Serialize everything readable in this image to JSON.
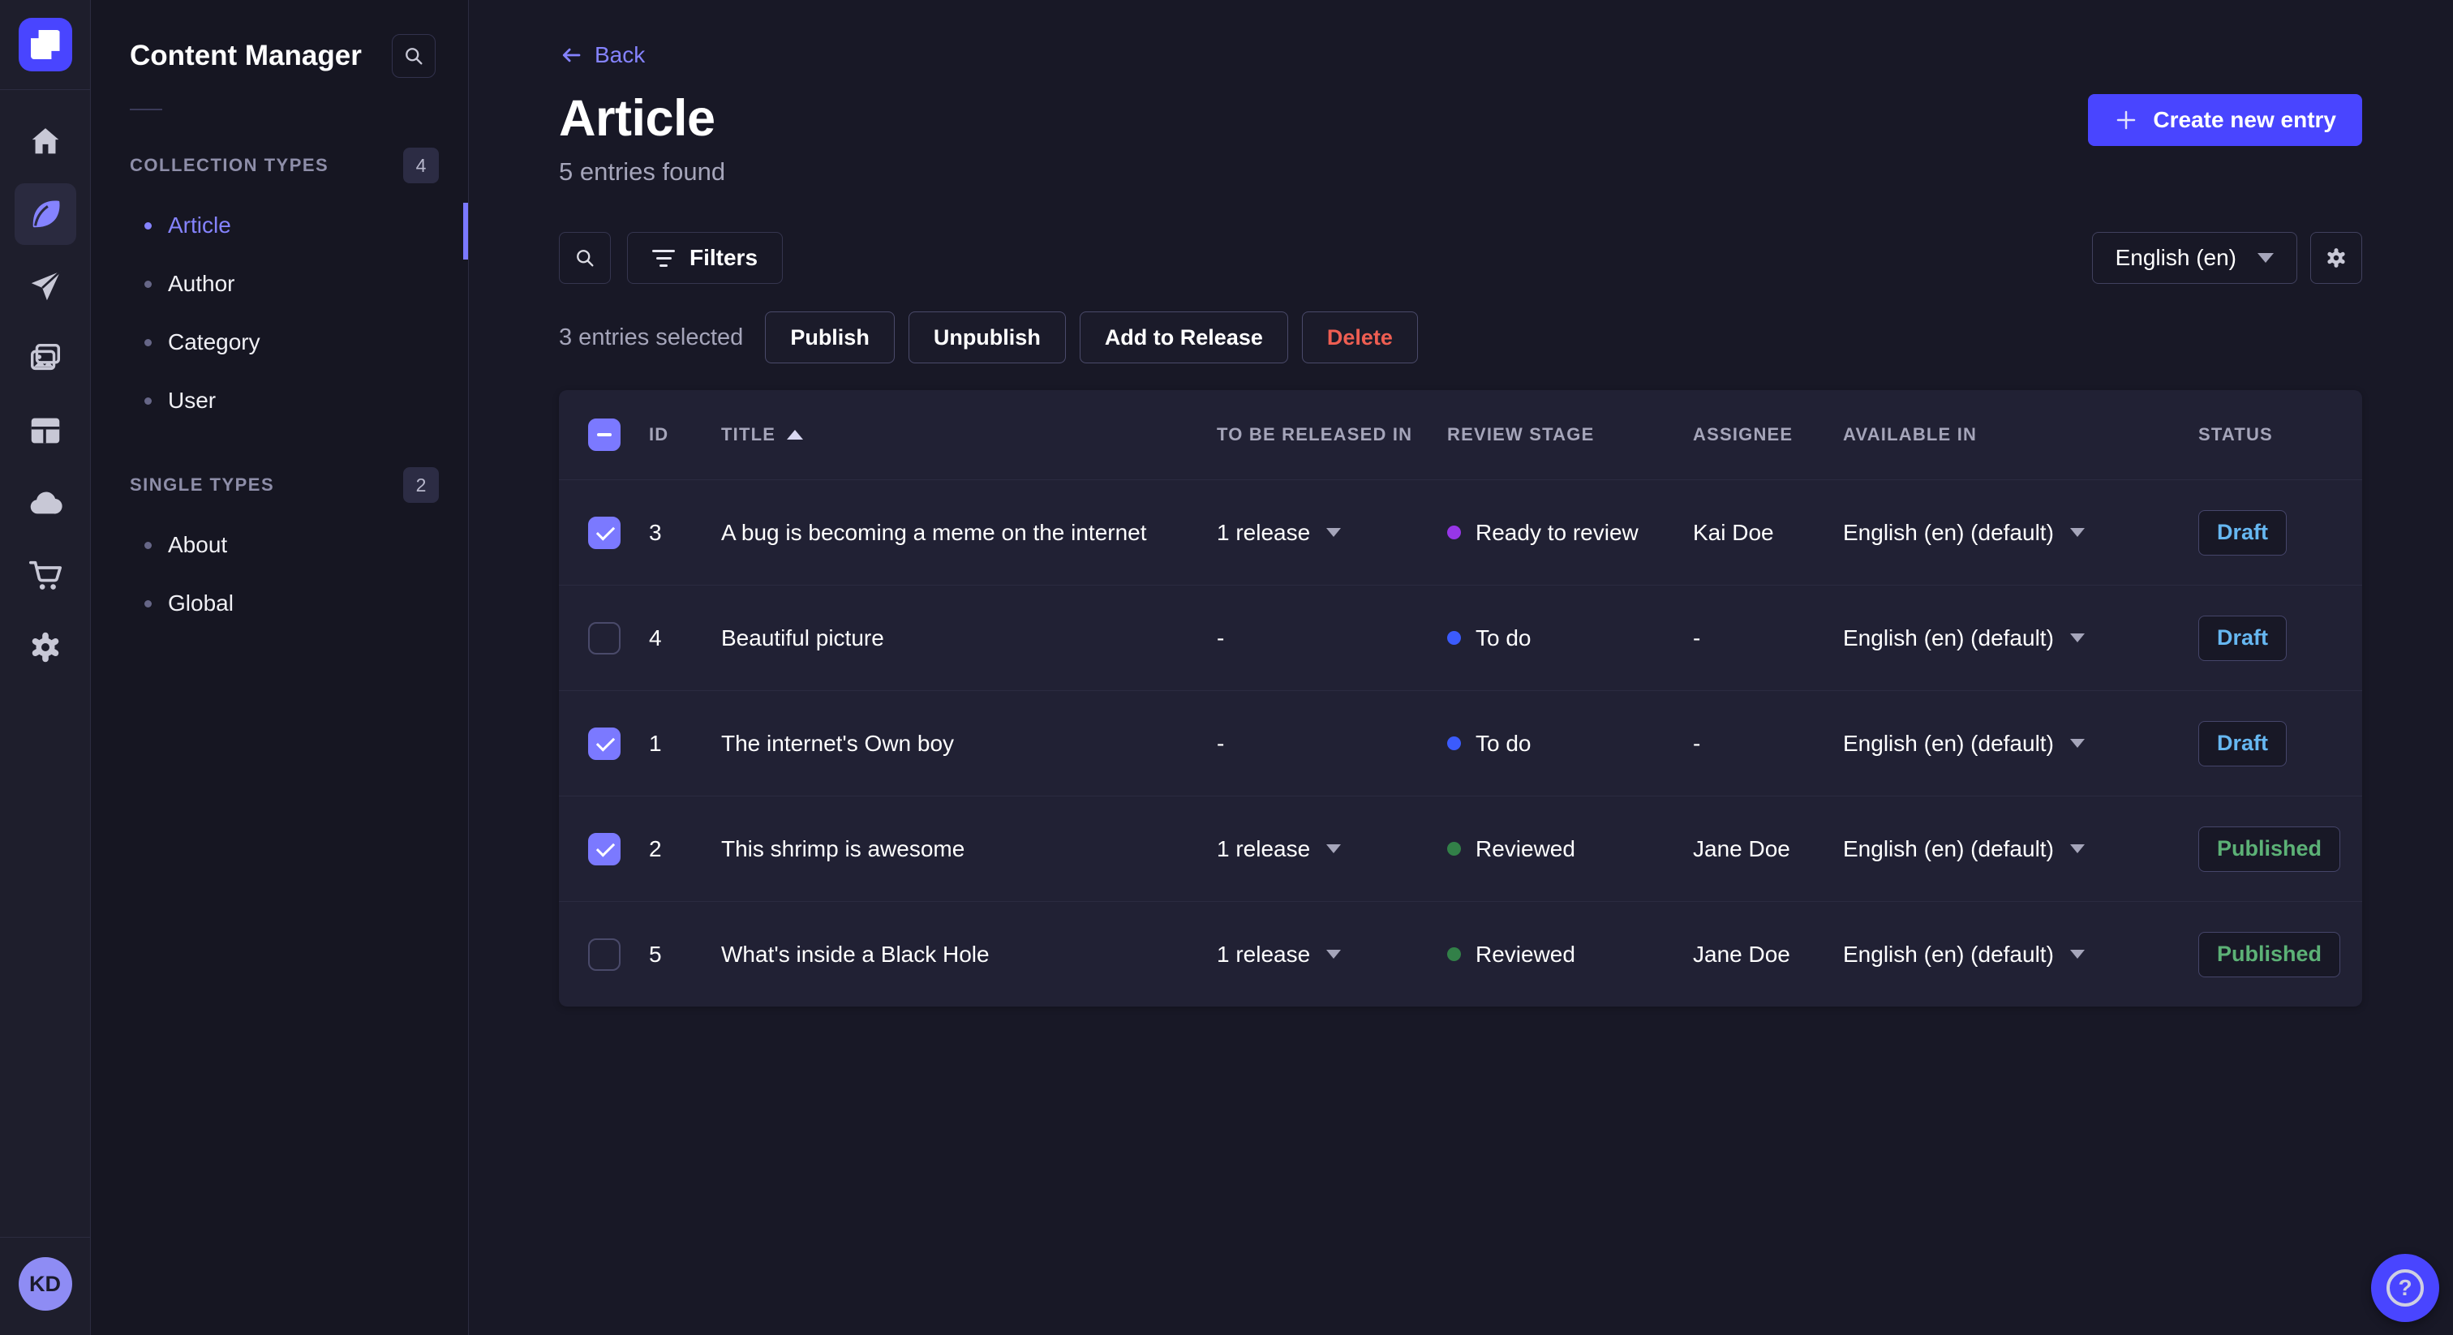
{
  "icon_rail": {
    "items": [
      {
        "icon": "home-icon",
        "active": false
      },
      {
        "icon": "content-manager-feather-icon",
        "active": true
      },
      {
        "icon": "release-send-icon",
        "active": false
      },
      {
        "icon": "media-library-icon",
        "active": false
      },
      {
        "icon": "content-type-builder-icon",
        "active": false
      },
      {
        "icon": "deploy-cloud-icon",
        "active": false
      },
      {
        "icon": "marketplace-cart-icon",
        "active": false
      },
      {
        "icon": "settings-gear-icon",
        "active": false
      }
    ],
    "avatar_initials": "KD"
  },
  "sidebar": {
    "title": "Content Manager",
    "sections": [
      {
        "label": "COLLECTION TYPES",
        "badge": "4",
        "items": [
          {
            "label": "Article",
            "active": "true"
          },
          {
            "label": "Author",
            "active": "false"
          },
          {
            "label": "Category",
            "active": "false"
          },
          {
            "label": "User",
            "active": "false"
          }
        ]
      },
      {
        "label": "SINGLE TYPES",
        "badge": "2",
        "items": [
          {
            "label": "About",
            "active": "false"
          },
          {
            "label": "Global",
            "active": "false"
          }
        ]
      }
    ]
  },
  "header": {
    "back_label": "Back",
    "title": "Article",
    "subtitle": "5 entries found",
    "create_button_label": "Create new entry"
  },
  "toolbar": {
    "filters_label": "Filters",
    "locale_value": "English (en)"
  },
  "selection": {
    "label": "3 entries selected",
    "publish_label": "Publish",
    "unpublish_label": "Unpublish",
    "add_to_release_label": "Add to Release",
    "delete_label": "Delete"
  },
  "table": {
    "columns": {
      "id": "ID",
      "title": "TITLE",
      "release": "TO BE RELEASED IN",
      "stage": "REVIEW STAGE",
      "assignee": "ASSIGNEE",
      "available": "AVAILABLE IN",
      "status": "STATUS"
    },
    "sort": {
      "column": "TITLE",
      "direction": "ascending"
    },
    "rows": [
      {
        "checked": "true",
        "id": "3",
        "title": "A bug is becoming a meme on the internet",
        "release": "1 release",
        "release_caret": "true",
        "stage": "Ready to review",
        "stage_color": "#9736e8",
        "assignee": "Kai Doe",
        "locale": "English (en) (default)",
        "status": "Draft",
        "status_type": "draft"
      },
      {
        "checked": "false",
        "id": "4",
        "title": "Beautiful picture",
        "release": "-",
        "release_caret": "false",
        "stage": "To do",
        "stage_color": "#3b5bfd",
        "assignee": "-",
        "locale": "English (en) (default)",
        "status": "Draft",
        "status_type": "draft"
      },
      {
        "checked": "true",
        "id": "1",
        "title": "The internet's Own boy",
        "release": "-",
        "release_caret": "false",
        "stage": "To do",
        "stage_color": "#3b5bfd",
        "assignee": "-",
        "locale": "English (en) (default)",
        "status": "Draft",
        "status_type": "draft"
      },
      {
        "checked": "true",
        "id": "2",
        "title": "This shrimp is awesome",
        "release": "1 release",
        "release_caret": "true",
        "stage": "Reviewed",
        "stage_color": "#328048",
        "assignee": "Jane Doe",
        "locale": "English (en) (default)",
        "status": "Published",
        "status_type": "published"
      },
      {
        "checked": "false",
        "id": "5",
        "title": "What's inside a Black Hole",
        "release": "1 release",
        "release_caret": "true",
        "stage": "Reviewed",
        "stage_color": "#328048",
        "assignee": "Jane Doe",
        "locale": "English (en) (default)",
        "status": "Published",
        "status_type": "published"
      }
    ]
  },
  "fab": {
    "glyph": "?"
  },
  "colors": {
    "primary": "#4945ff",
    "primary_light": "#8583ff",
    "checkbox_checked": "#7b79ff",
    "draft_text": "#66b7f1",
    "published_text": "#5cb176",
    "danger_text": "#ee5e52",
    "stage_todo": "#3b5bfd",
    "stage_ready_to_review": "#9736e8",
    "stage_reviewed": "#328048",
    "page_bg": "#181826",
    "card_bg": "#212134"
  }
}
